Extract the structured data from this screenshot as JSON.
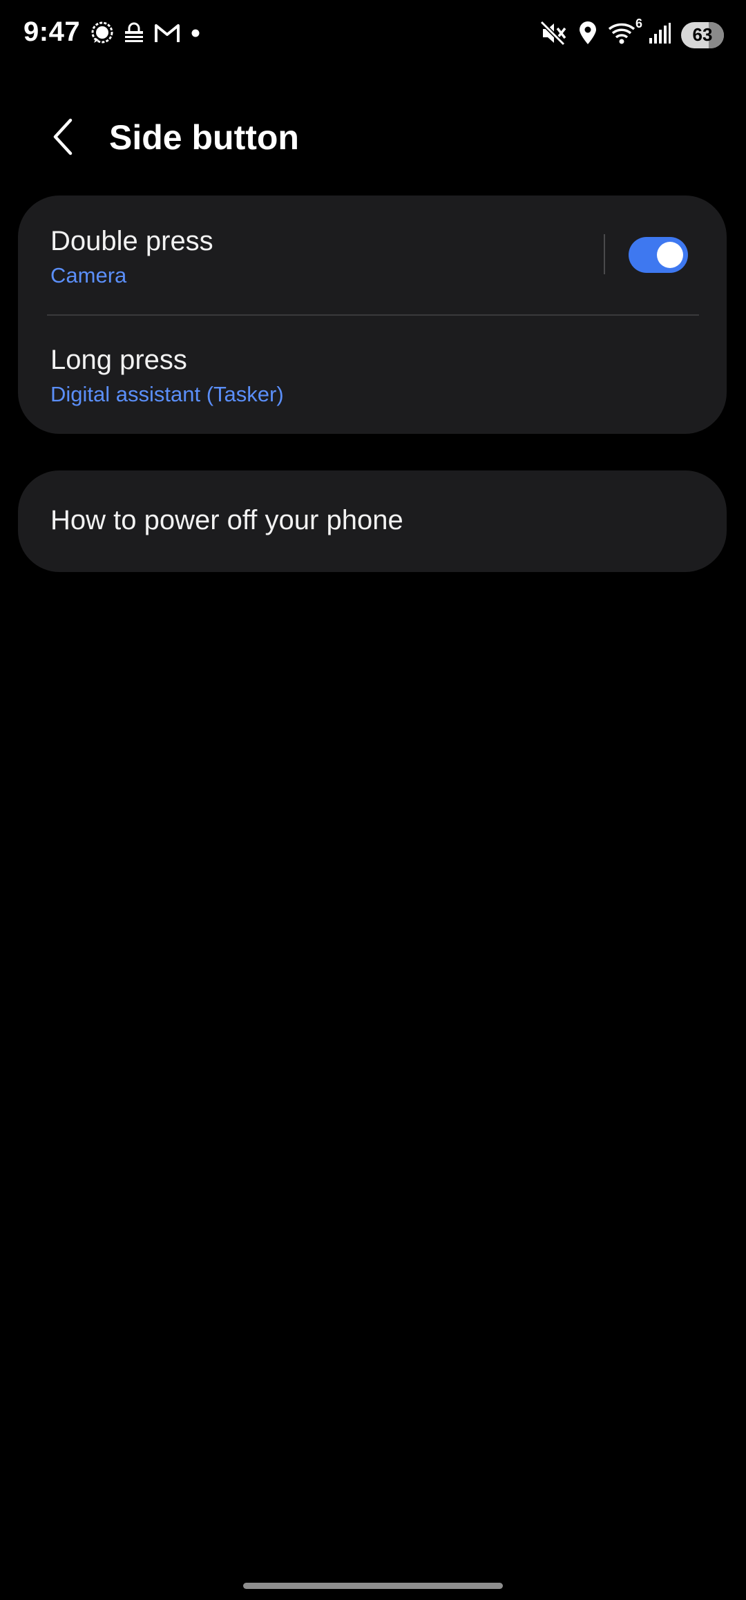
{
  "status_bar": {
    "time": "9:47",
    "battery": "63",
    "left_icons": [
      "signal-messenger-icon",
      "vpn-lock-icon",
      "gmail-icon",
      "notification-dot-icon"
    ],
    "right_icons": [
      "mute-icon",
      "location-icon",
      "wifi-6-icon",
      "cellular-signal-icon",
      "battery-icon"
    ],
    "wifi_badge": "6"
  },
  "header": {
    "title": "Side button",
    "back_icon": "chevron-left-icon"
  },
  "settings": {
    "double_press": {
      "title": "Double press",
      "subtitle": "Camera",
      "toggle_on": true
    },
    "long_press": {
      "title": "Long press",
      "subtitle": "Digital assistant (Tasker)"
    }
  },
  "power_off": {
    "title": "How to power off your phone"
  },
  "colors": {
    "background": "#000000",
    "card": "#1c1c1e",
    "accent": "#5b8ff9",
    "toggle": "#3e78f0"
  }
}
